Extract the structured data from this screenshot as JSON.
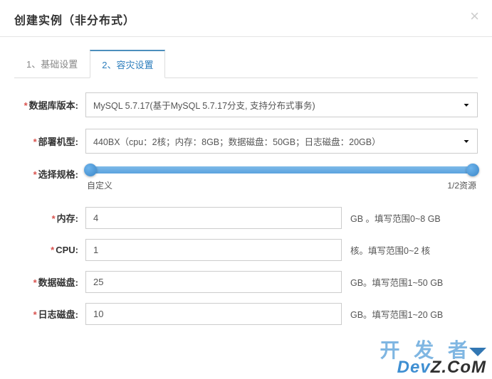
{
  "header": {
    "title": "创建实例（非分布式）",
    "close_label": "×"
  },
  "tabs": [
    {
      "label": "1、基础设置",
      "active": false
    },
    {
      "label": "2、容灾设置",
      "active": true
    }
  ],
  "form": {
    "db_version": {
      "label": "数据库版本:",
      "value": "MySQL 5.7.17(基于MySQL 5.7.17分支, 支持分布式事务)"
    },
    "deploy_type": {
      "label": "部署机型:",
      "value": "440BX（cpu：2核；内存：8GB；数据磁盘：50GB；日志磁盘：20GB）"
    },
    "spec": {
      "label": "选择规格:",
      "min_label": "自定义",
      "max_label": "1/2资源"
    },
    "memory": {
      "label": "内存:",
      "value": "4",
      "hint": "GB 。填写范围0~8 GB"
    },
    "cpu": {
      "label": "CPU:",
      "value": "1",
      "hint": "核。填写范围0~2 核"
    },
    "data_disk": {
      "label": "数据磁盘:",
      "value": "25",
      "hint": "GB。填写范围1~50 GB"
    },
    "log_disk": {
      "label": "日志磁盘:",
      "value": "10",
      "hint": "GB。填写范围1~20 GB"
    }
  },
  "watermark": {
    "line1": "开 发 者",
    "line2_a": "Dev",
    "line2_b": "Z.CoM"
  }
}
